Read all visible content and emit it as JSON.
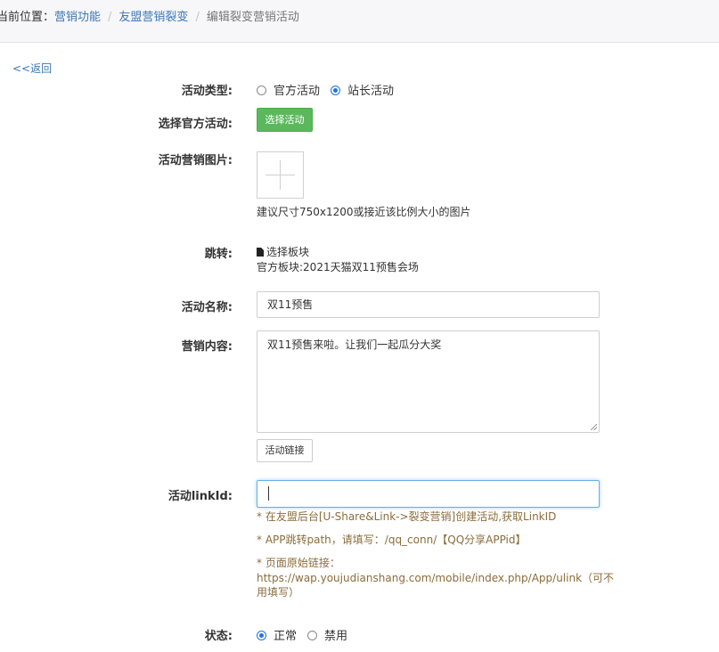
{
  "breadcrumb": {
    "label": "当前位置：",
    "items": [
      "营销功能",
      "友盟营销裂变"
    ],
    "separator": "/",
    "current": "编辑裂变营销活动"
  },
  "back_link": "<<返回",
  "form": {
    "activity_type": {
      "label": "活动类型:",
      "options": [
        {
          "text": "官方活动",
          "checked": false
        },
        {
          "text": "站长活动",
          "checked": true
        }
      ]
    },
    "official_activity": {
      "label": "选择官方活动:",
      "button": "选择活动"
    },
    "image": {
      "label": "活动营销图片:",
      "hint": "建议尺寸750x1200或接近该比例大小的图片"
    },
    "jump": {
      "label": "跳转:",
      "select_text": "选择板块",
      "info": "官方板块:2021天猫双11预售会场"
    },
    "name": {
      "label": "活动名称:",
      "value": "双11预售"
    },
    "content": {
      "label": "营销内容:",
      "value": "双11预售来啦。让我们一起瓜分大奖",
      "link_button": "活动链接"
    },
    "link_id": {
      "label": "活动linkId:",
      "value": "",
      "notes": [
        "* 在友盟后台[U-Share&Link->裂变营销]创建活动,获取LinkID",
        "* APP跳转path，请填写：/qq_conn/【QQ分享APPid】",
        "* 页面原始链接：",
        "https://wap.youjudianshang.com/mobile/index.php/App/ulink（可不",
        "用填写）"
      ]
    },
    "status": {
      "label": "状态:",
      "options": [
        {
          "text": "正常",
          "checked": true
        },
        {
          "text": "禁用",
          "checked": false
        }
      ]
    }
  },
  "colors": {
    "link": "#3a78b7",
    "green_button": "#5cb85c",
    "note": "#8a6d3b",
    "radio_checked": "#1f73e8",
    "focus": "#66afe9"
  }
}
